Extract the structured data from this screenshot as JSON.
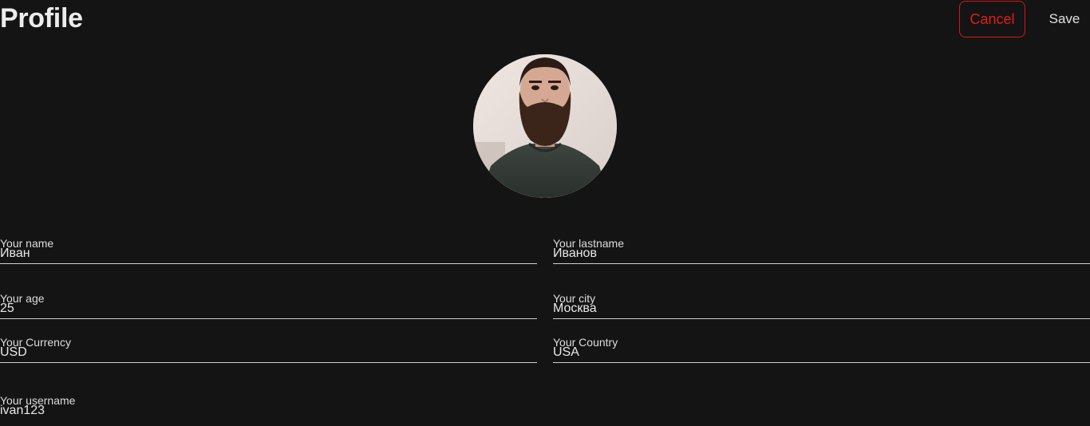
{
  "header": {
    "title": "Profile",
    "cancel_label": "Cancel",
    "save_label": "Save"
  },
  "colors": {
    "background": "#141414",
    "cancel_accent": "#e21c1c",
    "text": "#e6e6e6"
  },
  "fields": {
    "name": {
      "label": "Your name",
      "value": "Иван"
    },
    "lastname": {
      "label": "Your lastname",
      "value": "Иванов"
    },
    "age": {
      "label": "Your age",
      "value": "25"
    },
    "city": {
      "label": "Your city",
      "value": "Москва"
    },
    "currency": {
      "label": "Your Currency",
      "value": "USD"
    },
    "country": {
      "label": "Your Country",
      "value": "USA"
    },
    "username": {
      "label": "Your username",
      "value": "ivan123"
    }
  }
}
